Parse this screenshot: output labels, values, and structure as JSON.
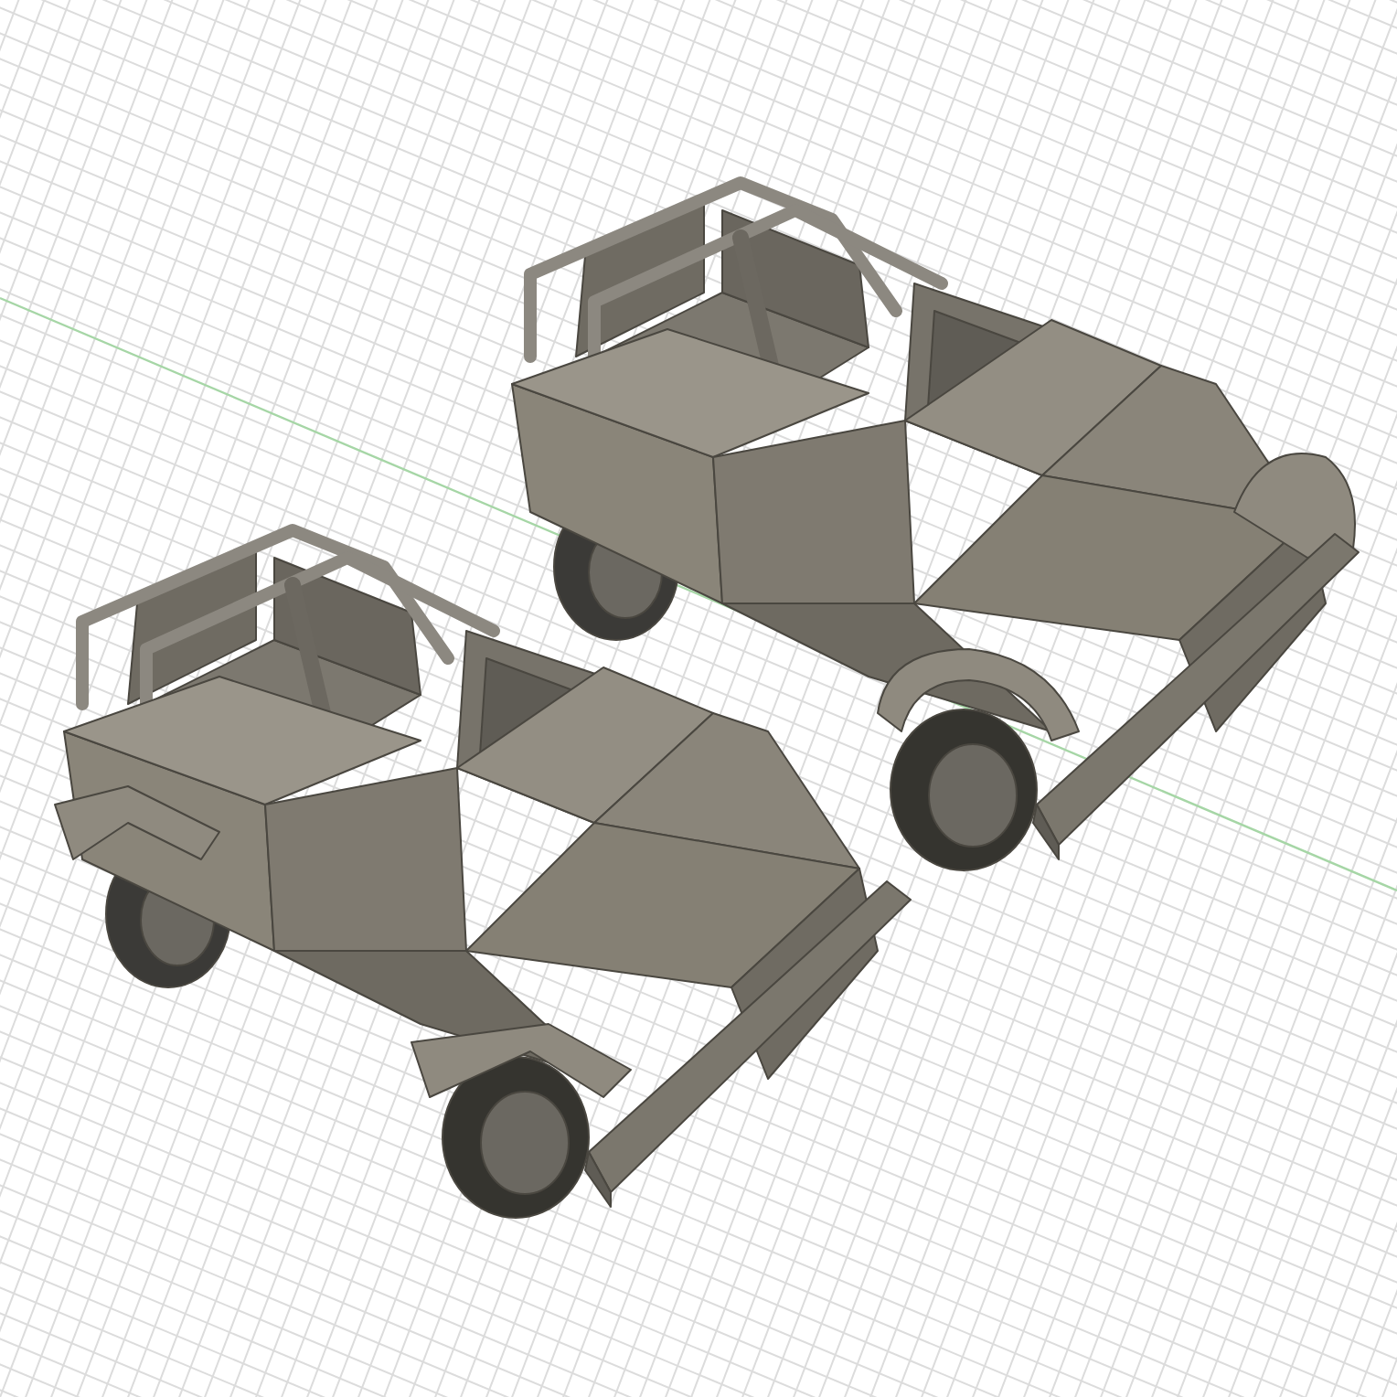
{
  "viewport": {
    "models": [
      {
        "kind": "rounded"
      },
      {
        "kind": "boxy"
      }
    ]
  }
}
